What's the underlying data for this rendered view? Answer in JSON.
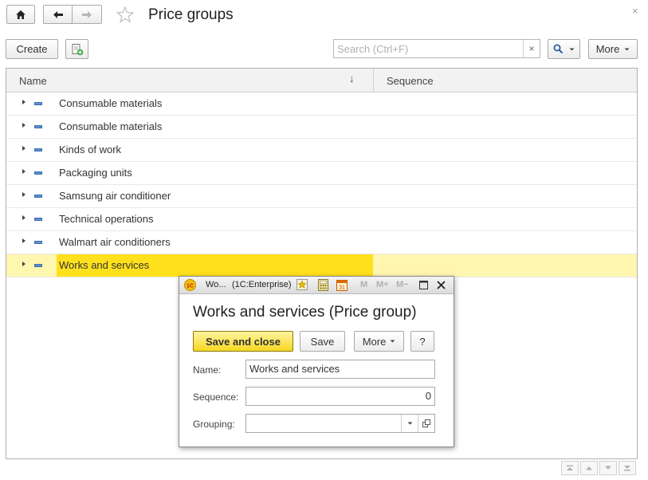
{
  "window": {
    "title": "Price groups",
    "close_glyph": "×"
  },
  "toolbar": {
    "create_label": "Create",
    "search_placeholder": "Search (Ctrl+F)",
    "search_value": "",
    "clear_glyph": "×",
    "more_label": "More"
  },
  "table": {
    "columns": {
      "name": "Name",
      "sort_glyph": "↓",
      "sequence": "Sequence"
    },
    "rows": [
      {
        "name": "Consumable materials",
        "sequence": ""
      },
      {
        "name": "Consumable materials",
        "sequence": ""
      },
      {
        "name": "Kinds of work",
        "sequence": ""
      },
      {
        "name": "Packaging units",
        "sequence": ""
      },
      {
        "name": "Samsung air conditioner",
        "sequence": ""
      },
      {
        "name": "Technical operations",
        "sequence": ""
      },
      {
        "name": "Walmart air conditioners",
        "sequence": ""
      },
      {
        "name": "Works and services",
        "sequence": "",
        "selected": true
      }
    ]
  },
  "dialog": {
    "caption": "Wo...",
    "app": "(1C:Enterprise)",
    "m_labels": [
      "M",
      "M+",
      "M−"
    ],
    "heading": "Works and services (Price group)",
    "save_close_label": "Save and close",
    "save_label": "Save",
    "more_label": "More",
    "help_label": "?",
    "name_label": "Name:",
    "name_value": "Works and services",
    "sequence_label": "Sequence:",
    "sequence_value": "0",
    "grouping_label": "Grouping:",
    "grouping_value": ""
  },
  "colors": {
    "selection": "#ffe01c",
    "selection_row": "#fff6b0",
    "accent_blue": "#3f6fae"
  },
  "icons": [
    "home-icon",
    "back-arrow-icon",
    "forward-arrow-icon",
    "star-icon",
    "add-copy-icon",
    "search-icon",
    "dropdown-icon",
    "close-icon"
  ]
}
